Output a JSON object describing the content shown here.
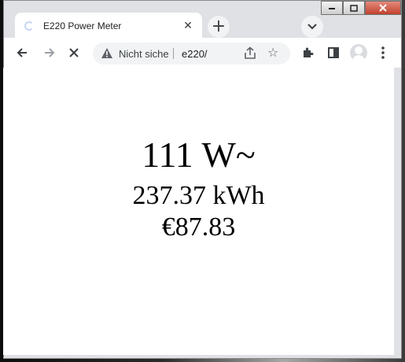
{
  "window": {
    "caption": {
      "minimize_icon": "minimize-icon",
      "maximize_icon": "maximize-icon",
      "close_icon": "close-icon"
    }
  },
  "tab": {
    "title": "E220 Power Meter",
    "loading_icon": "spinner-icon",
    "close_glyph": "✕"
  },
  "new_tab_glyph": "+",
  "tab_search_glyph": "⌄",
  "toolbar": {
    "security_label": "Nicht sicher",
    "url": "e220/",
    "icons": [
      "back-icon",
      "forward-icon",
      "stop-icon",
      "warning-icon",
      "share-icon",
      "star-icon",
      "extensions-icon",
      "sidepanel-icon",
      "profile-icon",
      "menu-icon"
    ]
  },
  "meter": {
    "power": "111 W~",
    "energy": "237.37 kWh",
    "cost": "€87.83"
  },
  "colors": {
    "page_bg": "#ffffff",
    "tabstrip_bg": "#dfe1e5",
    "omnibox_bg": "#f1f3f4",
    "text": "#000000"
  }
}
